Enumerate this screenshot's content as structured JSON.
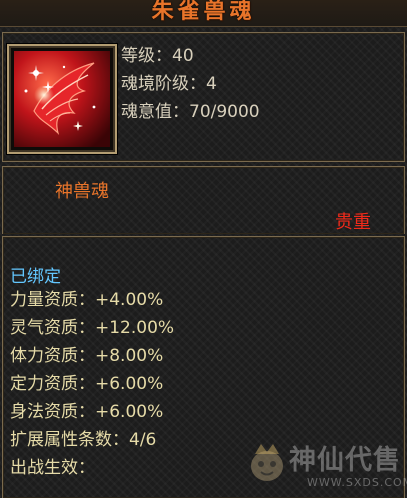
{
  "item": {
    "name": "朱雀兽魂",
    "icon": "vermilion-bird-icon",
    "stats": [
      {
        "label": "等级：",
        "value": "40"
      },
      {
        "label": "魂境阶级：",
        "value": "4"
      },
      {
        "label": "魂意值：",
        "value": "70/9000"
      }
    ],
    "type": "神兽魂",
    "rarity": "贵重",
    "bound": "已绑定",
    "attributes": [
      {
        "label": "力量资质：",
        "value": "+4.00%"
      },
      {
        "label": "灵气资质：",
        "value": "+12.00%"
      },
      {
        "label": "体力资质：",
        "value": "+8.00%"
      },
      {
        "label": "定力资质：",
        "value": "+6.00%"
      },
      {
        "label": "身法资质：",
        "value": "+6.00%"
      },
      {
        "label": "扩展属性条数：",
        "value": "4/6"
      },
      {
        "label": "出战生效：",
        "value": ""
      }
    ]
  },
  "watermark": {
    "text": "神仙代售",
    "url": "WWW.SXDS.COM",
    "icon": "mascot-logo-icon"
  },
  "colors": {
    "title": "#e8742a",
    "rarity": "#f02a1a",
    "bound": "#63c7ff",
    "attribute": "#e6dba8",
    "stat": "#d8d0bc"
  }
}
